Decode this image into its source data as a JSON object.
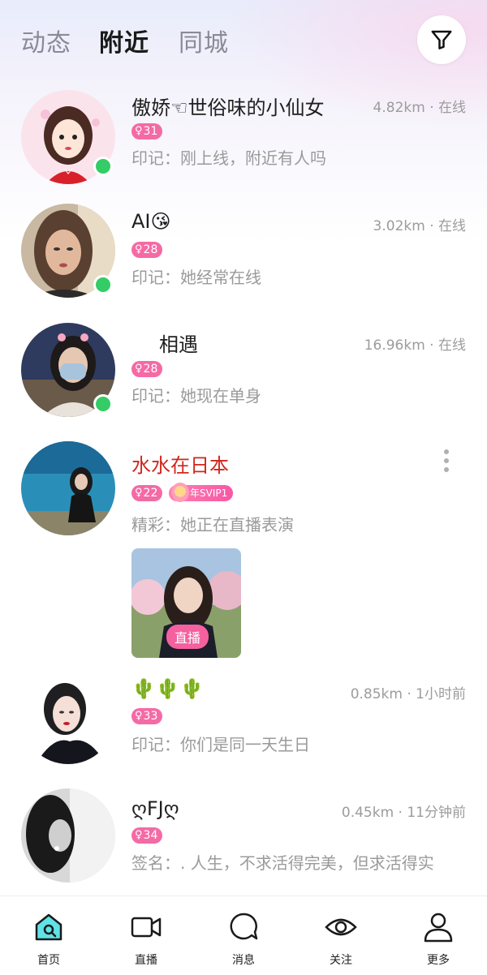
{
  "header": {
    "tabs": [
      {
        "label": "动态",
        "active": false
      },
      {
        "label": "附近",
        "active": true
      },
      {
        "label": "同城",
        "active": false
      }
    ],
    "filter_icon": "filter-icon"
  },
  "users": [
    {
      "name": "傲娇☜世俗味的小仙女",
      "distance": "4.82km · 在线",
      "age_badge": "31",
      "gender_symbol": "♀",
      "desc": "印记：刚上线，附近有人吗",
      "online": true
    },
    {
      "name": "AI😘",
      "distance": "3.02km · 在线",
      "age_badge": "28",
      "gender_symbol": "♀",
      "desc": "印记：她经常在线",
      "online": true
    },
    {
      "name": "相遇",
      "distance": "16.96km · 在线",
      "age_badge": "28",
      "gender_symbol": "♀",
      "desc": "印记：她现在单身",
      "online": true
    },
    {
      "name": "水水在日本",
      "distance": "",
      "age_badge": "22",
      "gender_symbol": "♀",
      "svip": "年SVIP1",
      "desc": "精彩：她正在直播表演",
      "live_tag": "直播",
      "online": false
    },
    {
      "name": "🌵🌵🌵",
      "distance": "0.85km · 1小时前",
      "age_badge": "33",
      "gender_symbol": "♀",
      "desc": "印记：你们是同一天生日",
      "online": false
    },
    {
      "name": "ღFJღ",
      "distance": "0.45km · 11分钟前",
      "age_badge": "34",
      "gender_symbol": "♀",
      "desc": "签名：. 人生，不求活得完美，但求活得实",
      "online": false
    }
  ],
  "bottom_nav": [
    {
      "label": "首页",
      "icon": "home-icon",
      "active": true
    },
    {
      "label": "直播",
      "icon": "video-camera-icon",
      "active": false
    },
    {
      "label": "消息",
      "icon": "chat-bubble-icon",
      "active": false
    },
    {
      "label": "关注",
      "icon": "eye-icon",
      "active": false
    },
    {
      "label": "更多",
      "icon": "person-icon",
      "active": false
    }
  ],
  "colors": {
    "accent_pink": "#f46aa5",
    "online_green": "#33cc66",
    "vip_name_red": "#d0271d",
    "home_icon_cyan": "#5fe3e6"
  }
}
